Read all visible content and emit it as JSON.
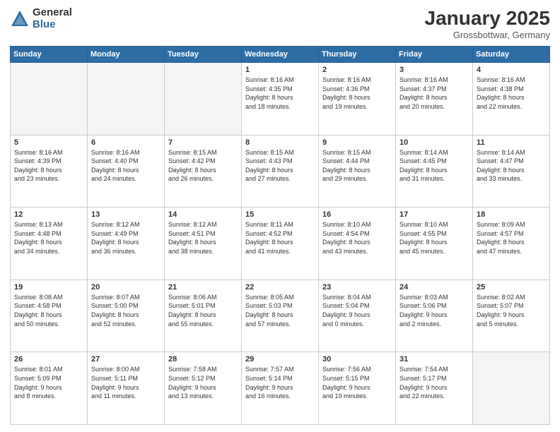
{
  "logo": {
    "general": "General",
    "blue": "Blue"
  },
  "title": {
    "month": "January 2025",
    "location": "Grossbottwar, Germany"
  },
  "weekdays": [
    "Sunday",
    "Monday",
    "Tuesday",
    "Wednesday",
    "Thursday",
    "Friday",
    "Saturday"
  ],
  "weeks": [
    [
      {
        "day": "",
        "text": ""
      },
      {
        "day": "",
        "text": ""
      },
      {
        "day": "",
        "text": ""
      },
      {
        "day": "1",
        "text": "Sunrise: 8:16 AM\nSunset: 4:35 PM\nDaylight: 8 hours\nand 18 minutes."
      },
      {
        "day": "2",
        "text": "Sunrise: 8:16 AM\nSunset: 4:36 PM\nDaylight: 8 hours\nand 19 minutes."
      },
      {
        "day": "3",
        "text": "Sunrise: 8:16 AM\nSunset: 4:37 PM\nDaylight: 8 hours\nand 20 minutes."
      },
      {
        "day": "4",
        "text": "Sunrise: 8:16 AM\nSunset: 4:38 PM\nDaylight: 8 hours\nand 22 minutes."
      }
    ],
    [
      {
        "day": "5",
        "text": "Sunrise: 8:16 AM\nSunset: 4:39 PM\nDaylight: 8 hours\nand 23 minutes."
      },
      {
        "day": "6",
        "text": "Sunrise: 8:16 AM\nSunset: 4:40 PM\nDaylight: 8 hours\nand 24 minutes."
      },
      {
        "day": "7",
        "text": "Sunrise: 8:15 AM\nSunset: 4:42 PM\nDaylight: 8 hours\nand 26 minutes."
      },
      {
        "day": "8",
        "text": "Sunrise: 8:15 AM\nSunset: 4:43 PM\nDaylight: 8 hours\nand 27 minutes."
      },
      {
        "day": "9",
        "text": "Sunrise: 8:15 AM\nSunset: 4:44 PM\nDaylight: 8 hours\nand 29 minutes."
      },
      {
        "day": "10",
        "text": "Sunrise: 8:14 AM\nSunset: 4:45 PM\nDaylight: 8 hours\nand 31 minutes."
      },
      {
        "day": "11",
        "text": "Sunrise: 8:14 AM\nSunset: 4:47 PM\nDaylight: 8 hours\nand 33 minutes."
      }
    ],
    [
      {
        "day": "12",
        "text": "Sunrise: 8:13 AM\nSunset: 4:48 PM\nDaylight: 8 hours\nand 34 minutes."
      },
      {
        "day": "13",
        "text": "Sunrise: 8:12 AM\nSunset: 4:49 PM\nDaylight: 8 hours\nand 36 minutes."
      },
      {
        "day": "14",
        "text": "Sunrise: 8:12 AM\nSunset: 4:51 PM\nDaylight: 8 hours\nand 38 minutes."
      },
      {
        "day": "15",
        "text": "Sunrise: 8:11 AM\nSunset: 4:52 PM\nDaylight: 8 hours\nand 41 minutes."
      },
      {
        "day": "16",
        "text": "Sunrise: 8:10 AM\nSunset: 4:54 PM\nDaylight: 8 hours\nand 43 minutes."
      },
      {
        "day": "17",
        "text": "Sunrise: 8:10 AM\nSunset: 4:55 PM\nDaylight: 8 hours\nand 45 minutes."
      },
      {
        "day": "18",
        "text": "Sunrise: 8:09 AM\nSunset: 4:57 PM\nDaylight: 8 hours\nand 47 minutes."
      }
    ],
    [
      {
        "day": "19",
        "text": "Sunrise: 8:08 AM\nSunset: 4:58 PM\nDaylight: 8 hours\nand 50 minutes."
      },
      {
        "day": "20",
        "text": "Sunrise: 8:07 AM\nSunset: 5:00 PM\nDaylight: 8 hours\nand 52 minutes."
      },
      {
        "day": "21",
        "text": "Sunrise: 8:06 AM\nSunset: 5:01 PM\nDaylight: 8 hours\nand 55 minutes."
      },
      {
        "day": "22",
        "text": "Sunrise: 8:05 AM\nSunset: 5:03 PM\nDaylight: 8 hours\nand 57 minutes."
      },
      {
        "day": "23",
        "text": "Sunrise: 8:04 AM\nSunset: 5:04 PM\nDaylight: 9 hours\nand 0 minutes."
      },
      {
        "day": "24",
        "text": "Sunrise: 8:03 AM\nSunset: 5:06 PM\nDaylight: 9 hours\nand 2 minutes."
      },
      {
        "day": "25",
        "text": "Sunrise: 8:02 AM\nSunset: 5:07 PM\nDaylight: 9 hours\nand 5 minutes."
      }
    ],
    [
      {
        "day": "26",
        "text": "Sunrise: 8:01 AM\nSunset: 5:09 PM\nDaylight: 9 hours\nand 8 minutes."
      },
      {
        "day": "27",
        "text": "Sunrise: 8:00 AM\nSunset: 5:11 PM\nDaylight: 9 hours\nand 11 minutes."
      },
      {
        "day": "28",
        "text": "Sunrise: 7:58 AM\nSunset: 5:12 PM\nDaylight: 9 hours\nand 13 minutes."
      },
      {
        "day": "29",
        "text": "Sunrise: 7:57 AM\nSunset: 5:14 PM\nDaylight: 9 hours\nand 16 minutes."
      },
      {
        "day": "30",
        "text": "Sunrise: 7:56 AM\nSunset: 5:15 PM\nDaylight: 9 hours\nand 19 minutes."
      },
      {
        "day": "31",
        "text": "Sunrise: 7:54 AM\nSunset: 5:17 PM\nDaylight: 9 hours\nand 22 minutes."
      },
      {
        "day": "",
        "text": ""
      }
    ]
  ]
}
